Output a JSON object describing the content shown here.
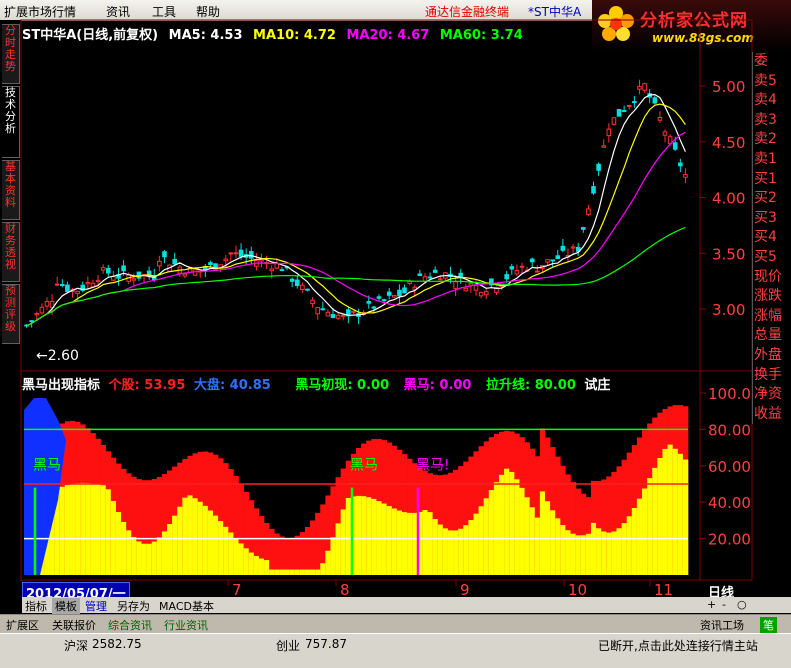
{
  "menu": {
    "items": [
      "扩展市场行情",
      "资讯",
      "工具",
      "帮助"
    ],
    "terminal_title": "通达信金融终端",
    "stock_title": "*ST中华A"
  },
  "logo": {
    "main": "分析家公式网",
    "url": "www.88gs.com"
  },
  "left_tabs": [
    "分时走势",
    "技术分析",
    "基本资料",
    "财务透视",
    "预测评级"
  ],
  "main_chart": {
    "title": "ST中华A(日线,前复权)",
    "ma": [
      {
        "label": "MA5: 4.53",
        "color": "#ffffff"
      },
      {
        "label": "MA10: 4.72",
        "color": "#ffff00"
      },
      {
        "label": "MA20: 4.67",
        "color": "#ff00ff"
      },
      {
        "label": "MA60: 3.74",
        "color": "#00ff00"
      }
    ],
    "low_label": "2.60",
    "y_ticks": [
      "5.00",
      "4.50",
      "4.00",
      "3.50",
      "3.00"
    ]
  },
  "indicator": {
    "title": "黑马出现指标",
    "values": [
      {
        "label": "个股: 53.95",
        "color": "#ff2020"
      },
      {
        "label": "大盘: 40.85",
        "color": "#3070ff"
      },
      {
        "label": "黑马初现: 0.00",
        "color": "#00ff00"
      },
      {
        "label": "黑马: 0.00",
        "color": "#ff00ff"
      },
      {
        "label": "拉升线: 80.00",
        "color": "#00ff00"
      },
      {
        "label": "试庄",
        "color": "#ffffff"
      }
    ],
    "y_ticks": [
      "100.0",
      "80.00",
      "60.00",
      "40.00",
      "20.00"
    ],
    "annotations": [
      "黑马",
      "黑马",
      "黑马!"
    ]
  },
  "x_axis": {
    "date_badge": "2012/05/07/一",
    "months": [
      "7",
      "8",
      "9",
      "10",
      "11"
    ],
    "period": "日线"
  },
  "right_panel": [
    "委",
    "卖5",
    "卖4",
    "卖3",
    "卖2",
    "卖1",
    "买1",
    "买2",
    "买3",
    "买4",
    "买5",
    "现价",
    "涨跌",
    "涨幅",
    "总量",
    "外盘",
    "换手",
    "净资",
    "收益"
  ],
  "toolbar": [
    "指标",
    "模板",
    "管理",
    "另存为",
    "MACD基本"
  ],
  "toolbar_right": [
    "+",
    "-",
    "○"
  ],
  "bottom_tabs": [
    "扩展区",
    "关联报价",
    "综合资讯",
    "行业资讯"
  ],
  "bottom_right_tabs": [
    "资讯工场",
    "笔"
  ],
  "status": {
    "sh_label": "沪深",
    "sh_value": "2582.75",
    "cy_label": "创业",
    "cy_value": "757.87",
    "conn": "已断开,点击此处连接行情主站"
  },
  "colors": {
    "up": "#ff3030",
    "down": "#00e0e0",
    "grid": "#800000",
    "ma5": "#ffffff",
    "ma10": "#ffff00",
    "ma20": "#ff00ff",
    "ma60": "#00ff00"
  }
}
